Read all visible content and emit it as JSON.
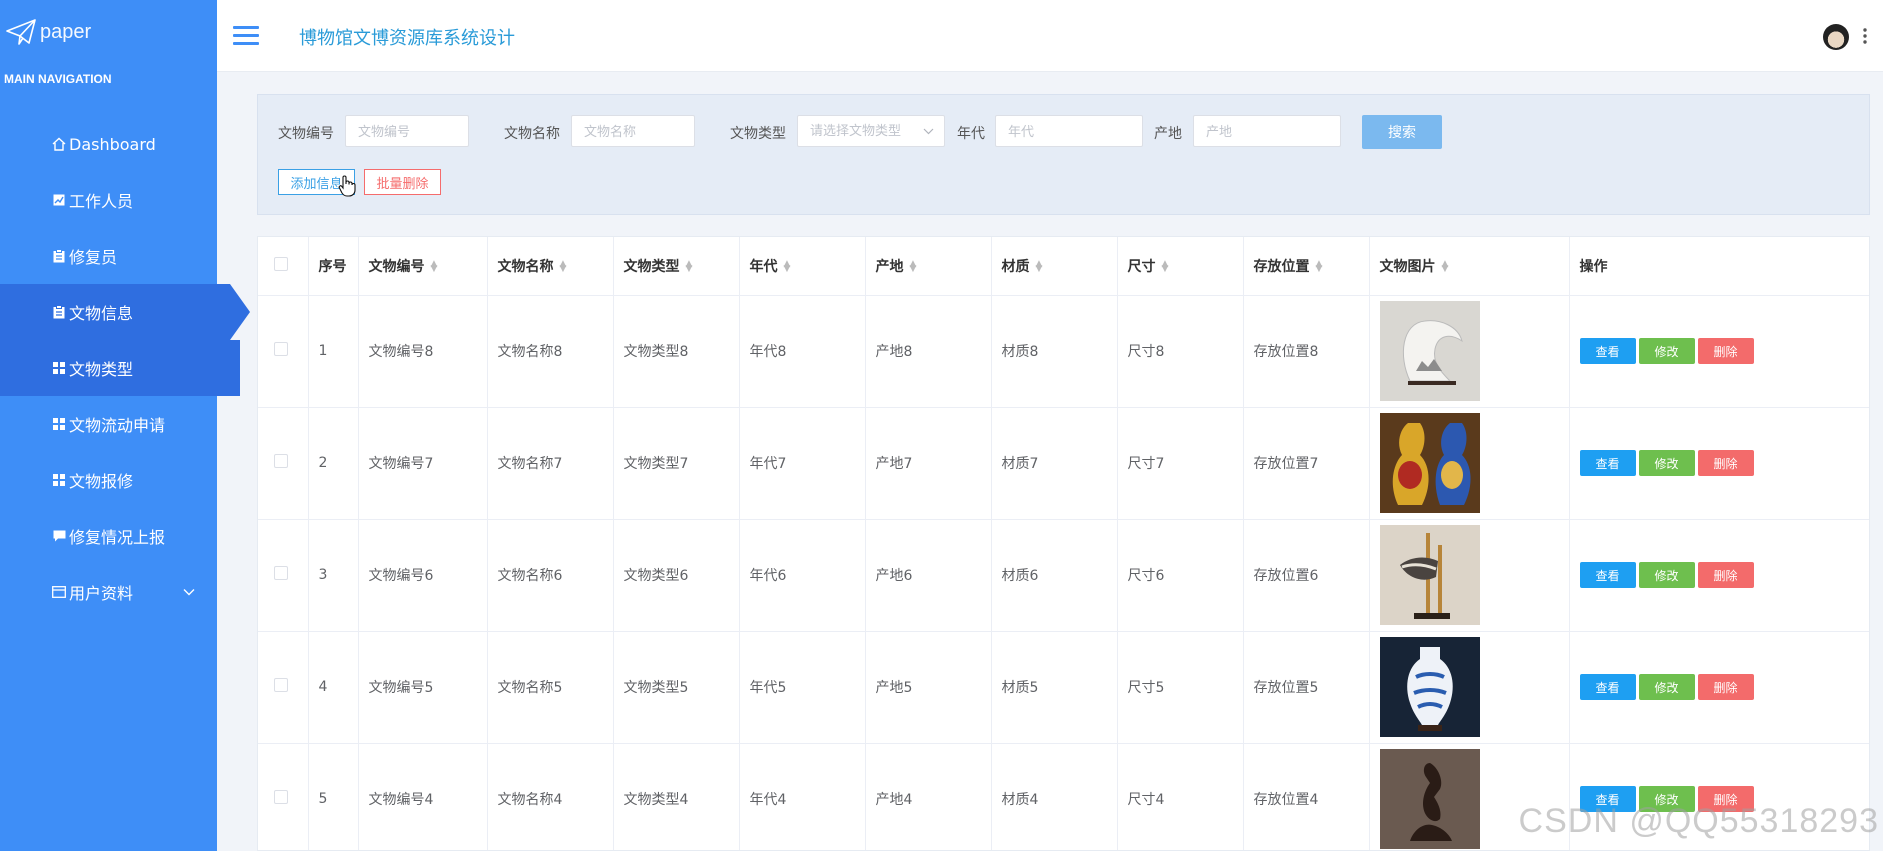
{
  "sidebar": {
    "logo_text": "paper",
    "nav_title": "MAIN NAVIGATION",
    "items": [
      {
        "label": "Dashboard",
        "icon": "home-icon"
      },
      {
        "label": "工作人员",
        "icon": "chart-icon"
      },
      {
        "label": "修复员",
        "icon": "clipboard-icon"
      },
      {
        "label": "文物信息",
        "icon": "clipboard-icon",
        "active": true
      },
      {
        "label": "文物类型",
        "icon": "grid-icon",
        "hover": true
      },
      {
        "label": "文物流动申请",
        "icon": "grid-icon"
      },
      {
        "label": "文物报修",
        "icon": "grid-icon"
      },
      {
        "label": "修复情况上报",
        "icon": "comment-icon"
      },
      {
        "label": "用户资料",
        "icon": "card-icon",
        "has_submenu": true
      }
    ]
  },
  "header": {
    "title": "博物馆文博资源库系统设计"
  },
  "search": {
    "fields": [
      {
        "label": "文物编号",
        "placeholder": "文物编号"
      },
      {
        "label": "文物名称",
        "placeholder": "文物名称"
      },
      {
        "label": "文物类型",
        "placeholder": "请选择文物类型"
      },
      {
        "label": "年代",
        "placeholder": "年代"
      },
      {
        "label": "产地",
        "placeholder": "产地"
      }
    ],
    "search_label": "搜索",
    "add_label": "添加信息",
    "batch_delete_label": "批量删除"
  },
  "table": {
    "columns": [
      "序号",
      "文物编号",
      "文物名称",
      "文物类型",
      "年代",
      "产地",
      "材质",
      "尺寸",
      "存放位置",
      "文物图片",
      "操作"
    ],
    "rows": [
      {
        "index": "1",
        "code": "文物编号8",
        "name": "文物名称8",
        "type": "文物类型8",
        "era": "年代8",
        "origin": "产地8",
        "material": "材质8",
        "size": "尺寸8",
        "location": "存放位置8"
      },
      {
        "index": "2",
        "code": "文物编号7",
        "name": "文物名称7",
        "type": "文物类型7",
        "era": "年代7",
        "origin": "产地7",
        "material": "材质7",
        "size": "尺寸7",
        "location": "存放位置7"
      },
      {
        "index": "3",
        "code": "文物编号6",
        "name": "文物名称6",
        "type": "文物类型6",
        "era": "年代6",
        "origin": "产地6",
        "material": "材质6",
        "size": "尺寸6",
        "location": "存放位置6"
      },
      {
        "index": "4",
        "code": "文物编号5",
        "name": "文物名称5",
        "type": "文物类型5",
        "era": "年代5",
        "origin": "产地5",
        "material": "材质5",
        "size": "尺寸5",
        "location": "存放位置5"
      },
      {
        "index": "5",
        "code": "文物编号4",
        "name": "文物名称4",
        "type": "文物类型4",
        "era": "年代4",
        "origin": "产地4",
        "material": "材质4",
        "size": "尺寸4",
        "location": "存放位置4"
      }
    ],
    "actions": {
      "view": "查看",
      "edit": "修改",
      "delete": "删除"
    }
  },
  "watermark": "CSDN @QQ55318293",
  "colors": {
    "sidebar": "#3e8ef7",
    "sidebar_active": "#2f6ee0",
    "title": "#2a9bd8",
    "view": "#1e9ff2",
    "edit": "#6ebf4e",
    "delete": "#f36b6b"
  }
}
